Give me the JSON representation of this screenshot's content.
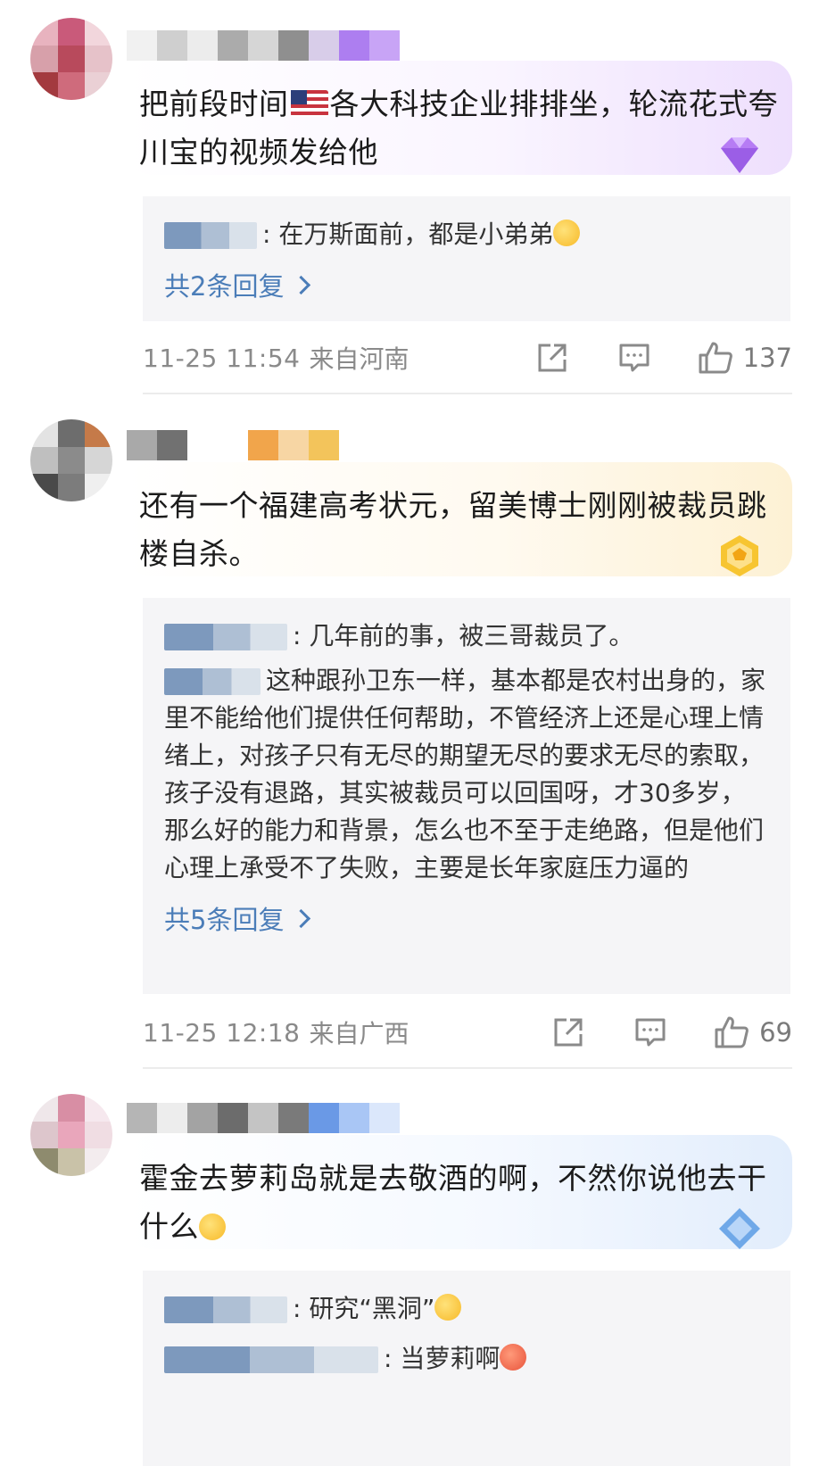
{
  "comments": [
    {
      "text_before_flag": "把前段时间",
      "text_after_flag": "各大科技企业排排坐，轮流花式夸川宝的视频发给他",
      "replies": [
        {
          "text": ": 在万斯面前，都是小弟弟"
        }
      ],
      "more_replies": "共2条回复",
      "time": "11-25 11:54",
      "location": "来自河南",
      "likes": "137",
      "badge_color": "#b07cf0"
    },
    {
      "text": "还有一个福建高考状元，留美博士刚刚被裁员跳楼自杀。",
      "replies": [
        {
          "text": ": 几年前的事，被三哥裁员了。"
        },
        {
          "text": "这种跟孙卫东一样，基本都是农村出身的，家里不能给他们提供任何帮助，不管经济上还是心理上情绪上，对孩子只有无尽的期望无尽的要求无尽的索取，孩子没有退路，其实被裁员可以回国呀，才30多岁，那么好的能力和背景，怎么也不至于走绝路，但是他们心理上承受不了失败，主要是长年家庭压力逼的"
        }
      ],
      "more_replies": "共5条回复",
      "time": "11-25 12:18",
      "location": "来自广西",
      "likes": "69",
      "badge_color": "#f3c22f"
    },
    {
      "text": "霍金去萝莉岛就是去敬酒的啊，不然你说他去干什么",
      "replies": [
        {
          "text": ": 研究“黑洞”"
        },
        {
          "text": ": 当萝莉啊"
        }
      ],
      "badge_color": "#6fa8e8"
    }
  ],
  "icons": {
    "share": "share-icon",
    "comment": "comment-icon",
    "like": "like-icon"
  }
}
